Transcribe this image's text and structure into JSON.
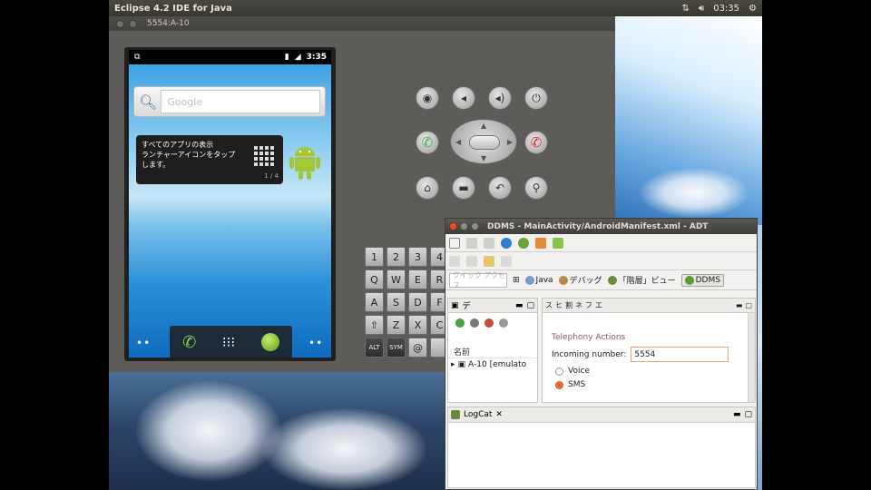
{
  "top_panel": {
    "title": "Eclipse 4.2 IDE for Java",
    "time": "03:35",
    "icons": [
      "network-icon",
      "volume-icon",
      "power-icon"
    ]
  },
  "emulator": {
    "window_title": "5554:A-10",
    "status_time": "3:35",
    "search_placeholder": "Google",
    "tip": {
      "line1": "すべてのアプリの表示",
      "line2": "ランチャーアイコンをタップ",
      "line3": "します。",
      "page": "1 / 4"
    },
    "keyboard_keys": [
      "1",
      "2",
      "3",
      "4",
      "Q",
      "W",
      "E",
      "R",
      "A",
      "S",
      "D",
      "F",
      "⇧",
      "Z",
      "X",
      "C",
      "ALT",
      "SYM",
      "@",
      ""
    ]
  },
  "ddms": {
    "title": "DDMS - MainActivity/AndroidManifest.xml - ADT",
    "quick_access": "クイック アクセス",
    "perspectives": [
      {
        "label": "Java"
      },
      {
        "label": "デバッグ"
      },
      {
        "label": "「階層」ビュー"
      },
      {
        "label": "DDMS"
      }
    ],
    "devices_tab": "デ",
    "devices_column": "名前",
    "device_row": "A-10 [emulato",
    "emulator_tabs": [
      "ス",
      "ヒ",
      "割",
      "ネ",
      "フ",
      "エ"
    ],
    "emulator_control": {
      "section": "Telephony Actions",
      "incoming_label": "Incoming number:",
      "incoming_value": "5554",
      "voice_label": "Voice",
      "sms_label": "SMS"
    },
    "logcat_tab": "LogCat"
  },
  "colors": {
    "ddms_accent": "#e2602b",
    "call_green": "#3bb54a",
    "end_red": "#d92b2b"
  }
}
